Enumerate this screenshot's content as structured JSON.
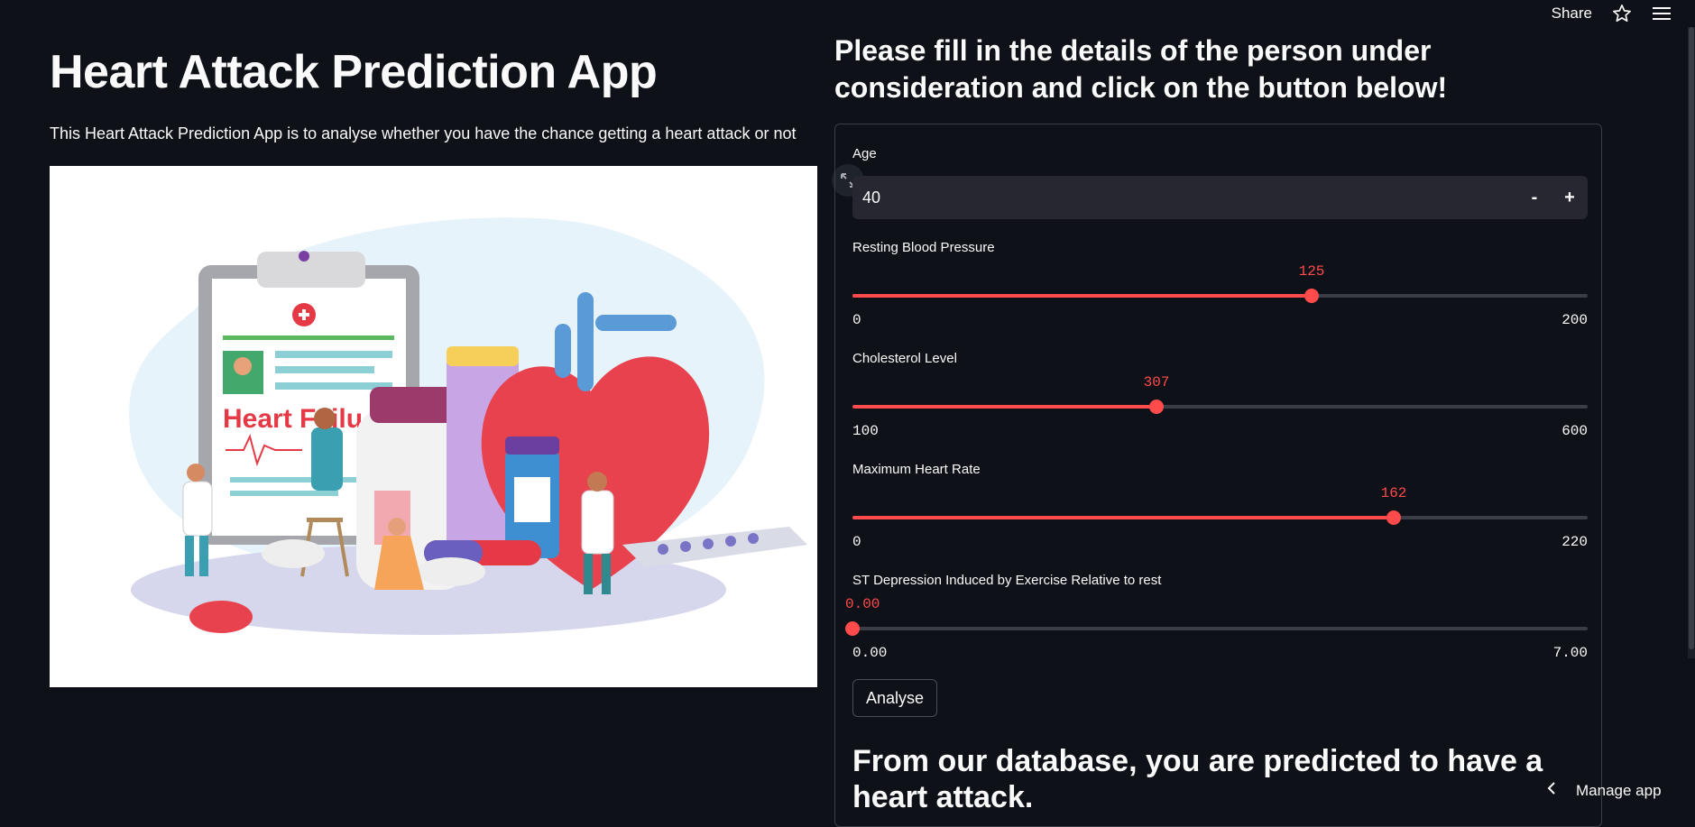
{
  "header": {
    "share_label": "Share",
    "star_icon": "star-icon",
    "menu_icon": "hamburger-menu-icon"
  },
  "left": {
    "title": "Heart Attack Prediction App",
    "subtitle": "This Heart Attack Prediction App is to analyse whether you have the chance getting a heart attack or not",
    "image_text": "Heart Failu"
  },
  "form": {
    "heading": "Please fill in the details of the person under consideration and click on the button below!",
    "age": {
      "label": "Age",
      "value": "40",
      "minus": "-",
      "plus": "+"
    },
    "sliders": [
      {
        "label": "Resting Blood Pressure",
        "value": "125",
        "min": "0",
        "max": "200",
        "fraction": 0.625
      },
      {
        "label": "Cholesterol Level",
        "value": "307",
        "min": "100",
        "max": "600",
        "fraction": 0.414
      },
      {
        "label": "Maximum Heart Rate",
        "value": "162",
        "min": "0",
        "max": "220",
        "fraction": 0.736
      },
      {
        "label": "ST Depression Induced by Exercise Relative to rest",
        "value": "0.00",
        "min": "0.00",
        "max": "7.00",
        "fraction": 0
      }
    ],
    "button_label": "Analyse",
    "result": "From our database, you are predicted to have a heart attack."
  },
  "footer": {
    "manage_label": "Manage app"
  },
  "colors": {
    "background": "#0e1117",
    "accent": "#ff4b4b",
    "input_bg": "#262730",
    "text": "#fafafa"
  }
}
